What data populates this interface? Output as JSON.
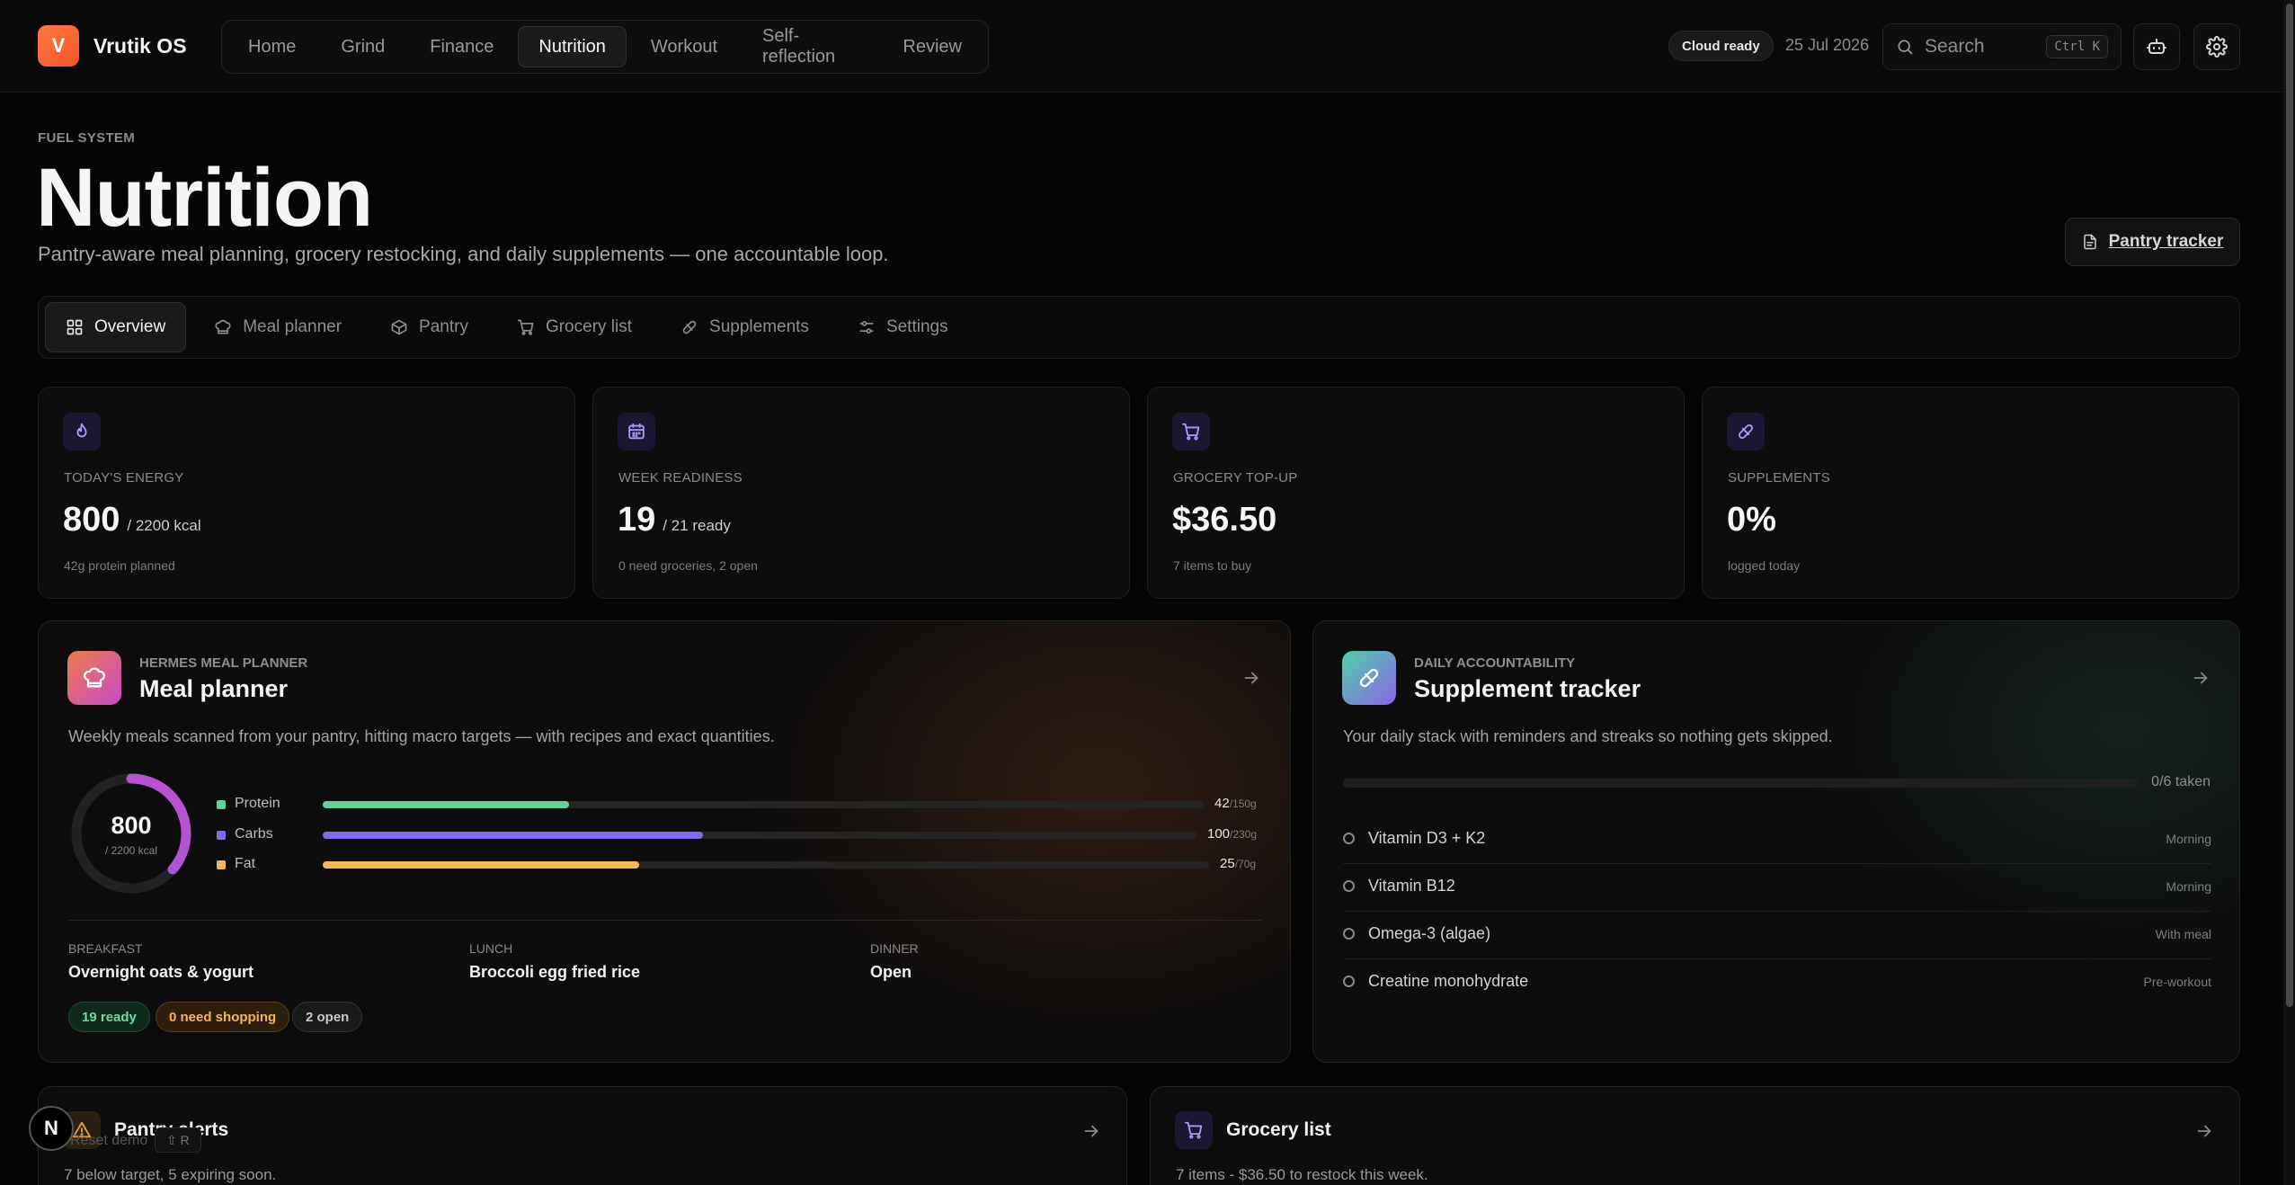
{
  "brand": {
    "logo_letter": "V",
    "name": "Vrutik OS"
  },
  "nav": {
    "items": [
      {
        "label": "Home"
      },
      {
        "label": "Grind"
      },
      {
        "label": "Finance"
      },
      {
        "label": "Nutrition",
        "active": true
      },
      {
        "label": "Workout"
      },
      {
        "label": "Self-reflection"
      },
      {
        "label": "Review"
      }
    ]
  },
  "status": {
    "cloud": "Cloud ready",
    "date": "25 Jul 2026"
  },
  "search": {
    "placeholder": "Search",
    "shortcut": "Ctrl K"
  },
  "header": {
    "eyebrow": "FUEL SYSTEM",
    "title": "Nutrition",
    "subtitle": "Pantry-aware meal planning, grocery restocking, and daily supplements — one accountable loop.",
    "pantry_button": "Pantry tracker"
  },
  "tabs": [
    {
      "label": "Overview",
      "icon": "grid-icon",
      "active": true
    },
    {
      "label": "Meal planner",
      "icon": "chef-hat-icon"
    },
    {
      "label": "Pantry",
      "icon": "box-icon"
    },
    {
      "label": "Grocery list",
      "icon": "cart-icon"
    },
    {
      "label": "Supplements",
      "icon": "pill-icon"
    },
    {
      "label": "Settings",
      "icon": "sliders-icon"
    }
  ],
  "stats": [
    {
      "label": "TODAY'S ENERGY",
      "value": "800",
      "unit": "/ 2200 kcal",
      "note": "42g protein planned",
      "icon": "flame-icon"
    },
    {
      "label": "WEEK READINESS",
      "value": "19",
      "unit": "/ 21 ready",
      "note": "0 need groceries, 2 open",
      "icon": "calendar-icon"
    },
    {
      "label": "GROCERY TOP-UP",
      "value": "$36.50",
      "unit": "",
      "note": "7 items to buy",
      "icon": "cart-icon"
    },
    {
      "label": "SUPPLEMENTS",
      "value": "0%",
      "unit": "",
      "note": "logged today",
      "icon": "pill-icon"
    }
  ],
  "meal_planner": {
    "eyebrow": "HERMES MEAL PLANNER",
    "title": "Meal planner",
    "description": "Weekly meals scanned from your pantry, hitting macro targets — with recipes and exact quantities.",
    "energy": {
      "value": "800",
      "target_label": "/ 2200 kcal",
      "consumed": 800,
      "target": 2200
    },
    "macros": [
      {
        "name": "Protein",
        "value": "42",
        "target_label": "/150g",
        "amount": 42,
        "target": 150,
        "color": "#5fd39a"
      },
      {
        "name": "Carbs",
        "value": "100",
        "target_label": "/230g",
        "amount": 100,
        "target": 230,
        "color": "#7b6cf2"
      },
      {
        "name": "Fat",
        "value": "25",
        "target_label": "/70g",
        "amount": 25,
        "target": 70,
        "color": "#f7b85c"
      }
    ],
    "meals": [
      {
        "slot": "BREAKFAST",
        "meal": "Overnight oats & yogurt"
      },
      {
        "slot": "LUNCH",
        "meal": "Broccoli egg fried rice"
      },
      {
        "slot": "DINNER",
        "meal": "Open"
      }
    ],
    "pills": [
      {
        "label": "19 ready"
      },
      {
        "label": "0 need shopping"
      },
      {
        "label": "2 open"
      }
    ]
  },
  "supplement_tracker": {
    "eyebrow": "DAILY ACCOUNTABILITY",
    "title": "Supplement tracker",
    "description": "Your daily stack with reminders and streaks so nothing gets skipped.",
    "progress_label": "0/6 taken",
    "taken": 0,
    "total": 6,
    "items": [
      {
        "name": "Vitamin D3 + K2",
        "time": "Morning"
      },
      {
        "name": "Vitamin B12",
        "time": "Morning"
      },
      {
        "name": "Omega-3 (algae)",
        "time": "With meal"
      },
      {
        "name": "Creatine monohydrate",
        "time": "Pre-workout"
      }
    ]
  },
  "pantry_alerts": {
    "title": "Pantry alerts",
    "description": "7 below target, 5 expiring soon."
  },
  "grocery_list": {
    "title": "Grocery list",
    "description": "7 items - $36.50 to restock this week."
  },
  "floating": {
    "badge": "N",
    "reset_label": "Reset demo",
    "reset_shortcut": "⇧ R"
  }
}
